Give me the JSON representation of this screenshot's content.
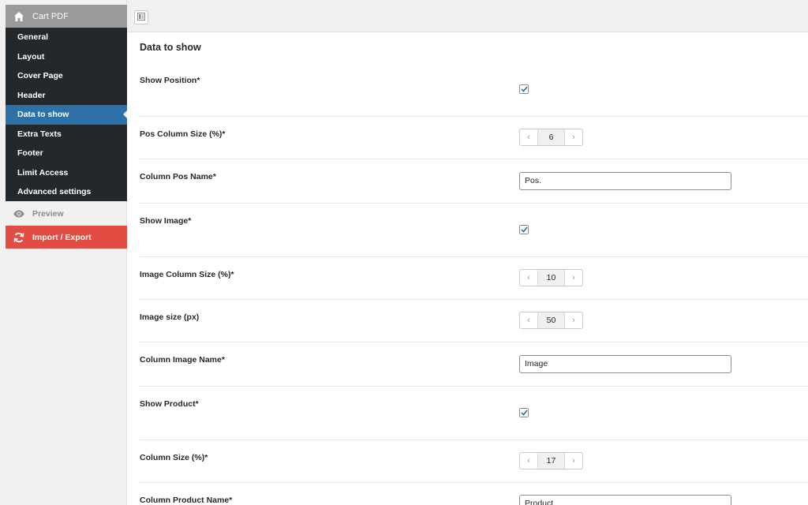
{
  "sidebar": {
    "app_title": "Cart PDF",
    "items": [
      {
        "label": "General"
      },
      {
        "label": "Layout"
      },
      {
        "label": "Cover Page"
      },
      {
        "label": "Header"
      },
      {
        "label": "Data to show"
      },
      {
        "label": "Extra Texts"
      },
      {
        "label": "Footer"
      },
      {
        "label": "Limit Access"
      },
      {
        "label": "Advanced settings"
      }
    ],
    "active_item": "Data to show",
    "preview_label": "Preview",
    "import_export_label": "Import / Export"
  },
  "main": {
    "section_title": "Data to show",
    "fields": {
      "show_position": {
        "label": "Show Position*",
        "checked": true
      },
      "pos_column_size": {
        "label": "Pos Column Size (%)*",
        "value": "6"
      },
      "column_pos_name": {
        "label": "Column Pos Name*",
        "value": "Pos."
      },
      "show_image": {
        "label": "Show Image*",
        "checked": true
      },
      "image_column_size": {
        "label": "Image Column Size (%)*",
        "value": "10"
      },
      "image_size": {
        "label": "Image size (px)",
        "value": "50"
      },
      "column_image_name": {
        "label": "Column Image Name*",
        "value": "Image"
      },
      "show_product": {
        "label": "Show Product*",
        "checked": true
      },
      "column_size": {
        "label": "Column Size (%)*",
        "value": "17"
      },
      "column_product_name": {
        "label": "Column Product Name*",
        "value": "Product"
      }
    }
  },
  "colors": {
    "active_item": "#2e70a8",
    "import_export": "#e14d43",
    "sidebar_dark": "#23282d",
    "checkbox_check": "#2271b1"
  }
}
